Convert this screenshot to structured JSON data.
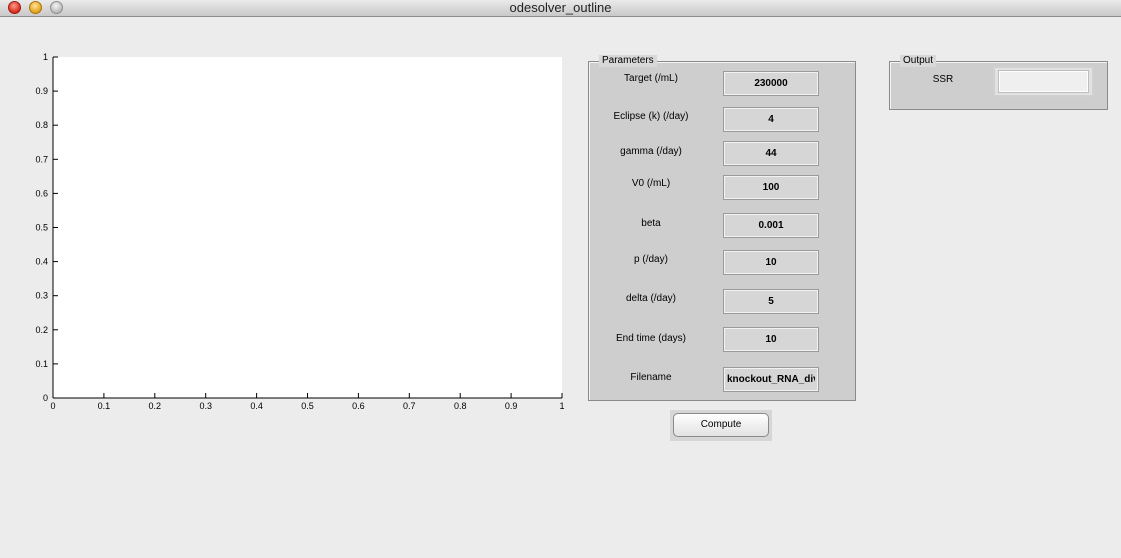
{
  "window": {
    "title": "odesolver_outline"
  },
  "plot": {
    "x_ticks": [
      "0",
      "0.1",
      "0.2",
      "0.3",
      "0.4",
      "0.5",
      "0.6",
      "0.7",
      "0.8",
      "0.9",
      "1"
    ],
    "y_ticks": [
      "0",
      "0.1",
      "0.2",
      "0.3",
      "0.4",
      "0.5",
      "0.6",
      "0.7",
      "0.8",
      "0.9",
      "1"
    ]
  },
  "chart_data": {
    "type": "line",
    "series": [],
    "xlim": [
      0,
      1
    ],
    "ylim": [
      0,
      1
    ],
    "grid": false
  },
  "parameters": {
    "title": "Parameters",
    "fields": [
      {
        "label": "Target (/mL)",
        "value": "230000"
      },
      {
        "label": "Eclipse (k) (/day)",
        "value": "4"
      },
      {
        "label": "gamma (/day)",
        "value": "44"
      },
      {
        "label": "V0 (/mL)",
        "value": "100"
      },
      {
        "label": "beta",
        "value": "0.001"
      },
      {
        "label": "p (/day)",
        "value": "10"
      },
      {
        "label": "delta (/day)",
        "value": "5"
      },
      {
        "label": "End time (days)",
        "value": "10"
      },
      {
        "label": "Filename",
        "value": "knockout_RNA_div"
      }
    ]
  },
  "compute_label": "Compute",
  "output": {
    "title": "Output",
    "ssr_label": "SSR",
    "ssr_value": ""
  }
}
